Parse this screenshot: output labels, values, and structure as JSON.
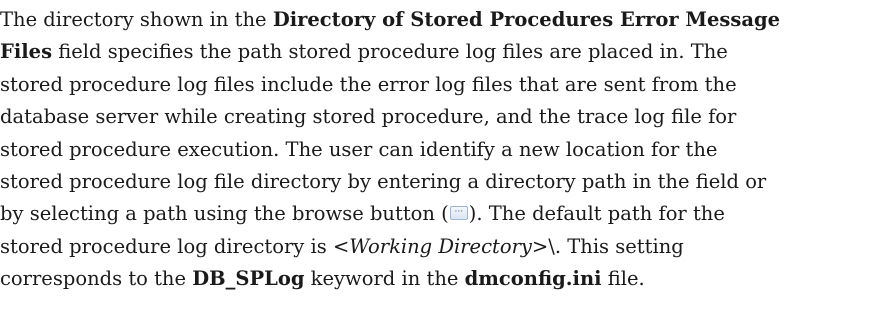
{
  "paragraph": {
    "l1_a": "The directory shown in the ",
    "l1_b": "Directory of Stored Procedures Error Message",
    "l2_a": "Files",
    "l2_b": " field specifies the path stored procedure log files are placed in. The",
    "l3": "stored procedure log files include the error log files that are sent from the",
    "l4": "database server while creating stored procedure, and the trace log file for",
    "l5": "stored procedure execution. The user can identify a new location for the",
    "l6": "stored procedure log file directory by entering a directory path in the field or",
    "l7_a": "by selecting a path using the browse button (",
    "browse_icon_glyph": "···",
    "l7_b": "). The default path for the",
    "l8_a": "stored procedure log directory is ",
    "l8_b": "<Working Directory>",
    "l8_c": "\\. This setting",
    "l9_a": "corresponds to the ",
    "l9_b": "DB_SPLog",
    "l9_c": " keyword in the ",
    "l9_d": "dmconfig.ini",
    "l9_e": " file."
  }
}
